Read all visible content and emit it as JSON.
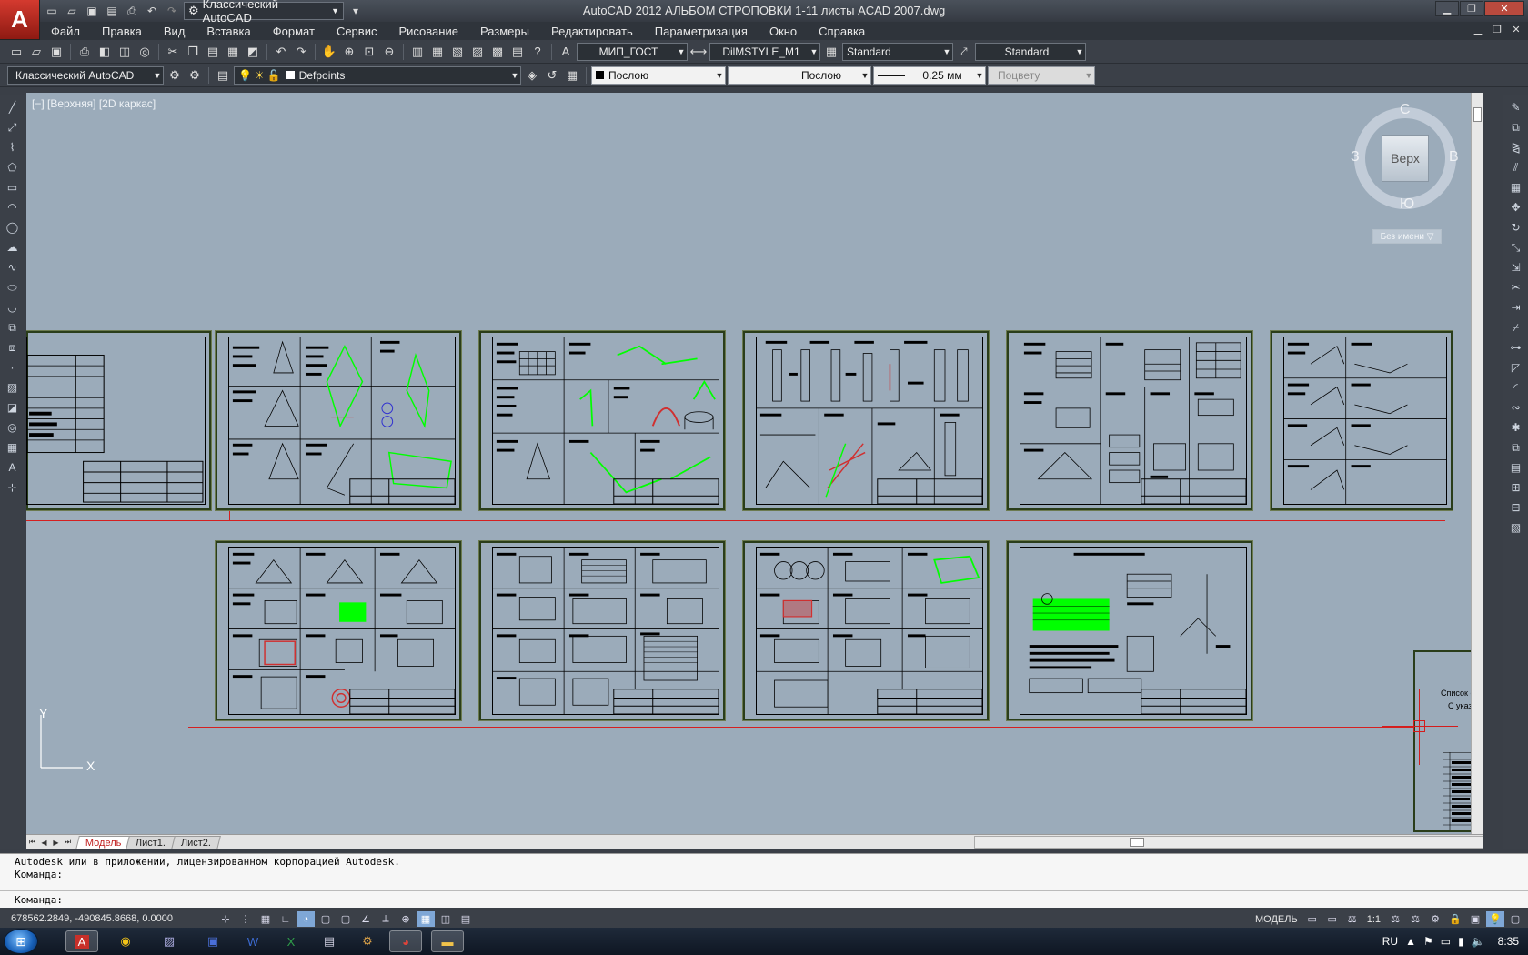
{
  "app": {
    "logo_letter": "A",
    "title": "AutoCAD 2012    АЛЬБОМ СТРОПОВКИ 1-11 листы ACAD 2007.dwg"
  },
  "qat": {
    "workspace": "Классический AutoCAD"
  },
  "menu": [
    "Файл",
    "Правка",
    "Вид",
    "Вставка",
    "Формат",
    "Сервис",
    "Рисование",
    "Размеры",
    "Редактировать",
    "Параметризация",
    "Окно",
    "Справка"
  ],
  "styles": {
    "text_style": "МИП_ГОСТ",
    "dim_style": "DilMSTYLE_M1",
    "table_style": "Standard",
    "mleader_style": "Standard"
  },
  "layers": {
    "workspace": "Классический AutoCAD",
    "current_layer": "Defpoints",
    "color": "Послою",
    "linetype": "Послою",
    "lineweight": "0.25 мм",
    "plotstyle": "Поцвету"
  },
  "viewport": {
    "label": "[−] [Верхняя] [2D каркас]",
    "navcube_face": "Верх",
    "dir_n": "С",
    "dir_s": "Ю",
    "dir_w": "З",
    "dir_e": "В",
    "ucs_name": "Без имени ▽",
    "ucs_x": "X",
    "ucs_y": "Y",
    "partial_text_1": "Список основны",
    "partial_text_2": "С указание"
  },
  "sheets_row1": [
    {
      "name": "sheet-1"
    },
    {
      "name": "sheet-2"
    },
    {
      "name": "sheet-3"
    },
    {
      "name": "sheet-4"
    },
    {
      "name": "sheet-5"
    },
    {
      "name": "sheet-6"
    }
  ],
  "tabs": [
    "Модель",
    "Лист1.",
    "Лист2."
  ],
  "command": {
    "line1": "Autodesk или в приложении, лицензированном корпорацией Autodesk.",
    "line2": "Команда:",
    "prompt": "Команда:"
  },
  "status": {
    "coords": "678562.2849, -490845.8668, 0.0000",
    "space": "МОДЕЛЬ",
    "scale": "1:1"
  },
  "taskbar": {
    "lang": "RU",
    "time": "8:35"
  },
  "colors": {
    "viewport_bg": "#9babba",
    "accent_red": "#d41c1c",
    "highlight_green": "#00ff00"
  }
}
